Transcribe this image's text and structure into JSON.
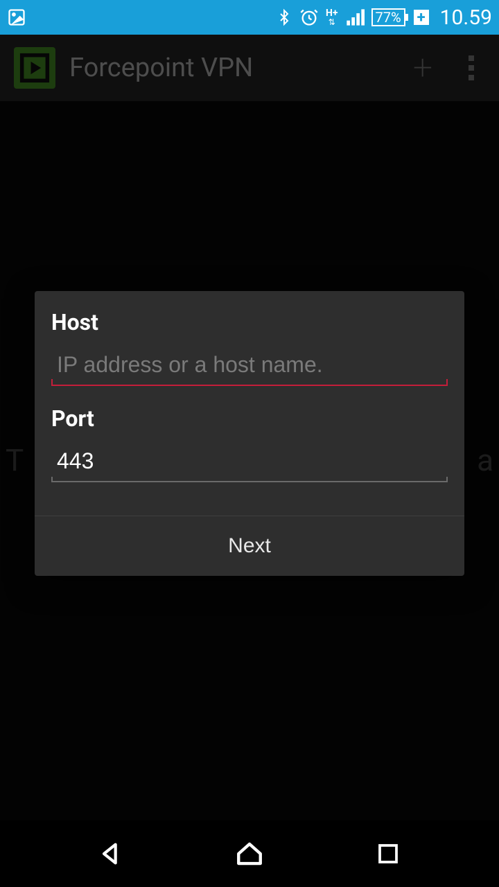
{
  "status_bar": {
    "battery_text": "77%",
    "time": "10.59",
    "network_label": "H+"
  },
  "app_bar": {
    "title": "Forcepoint VPN"
  },
  "dialog": {
    "host_label": "Host",
    "host_placeholder": "IP address or a host name.",
    "host_value": "",
    "port_label": "Port",
    "port_value": "443",
    "next_label": "Next"
  },
  "background": {
    "left_char": "T",
    "right_char": "a"
  }
}
